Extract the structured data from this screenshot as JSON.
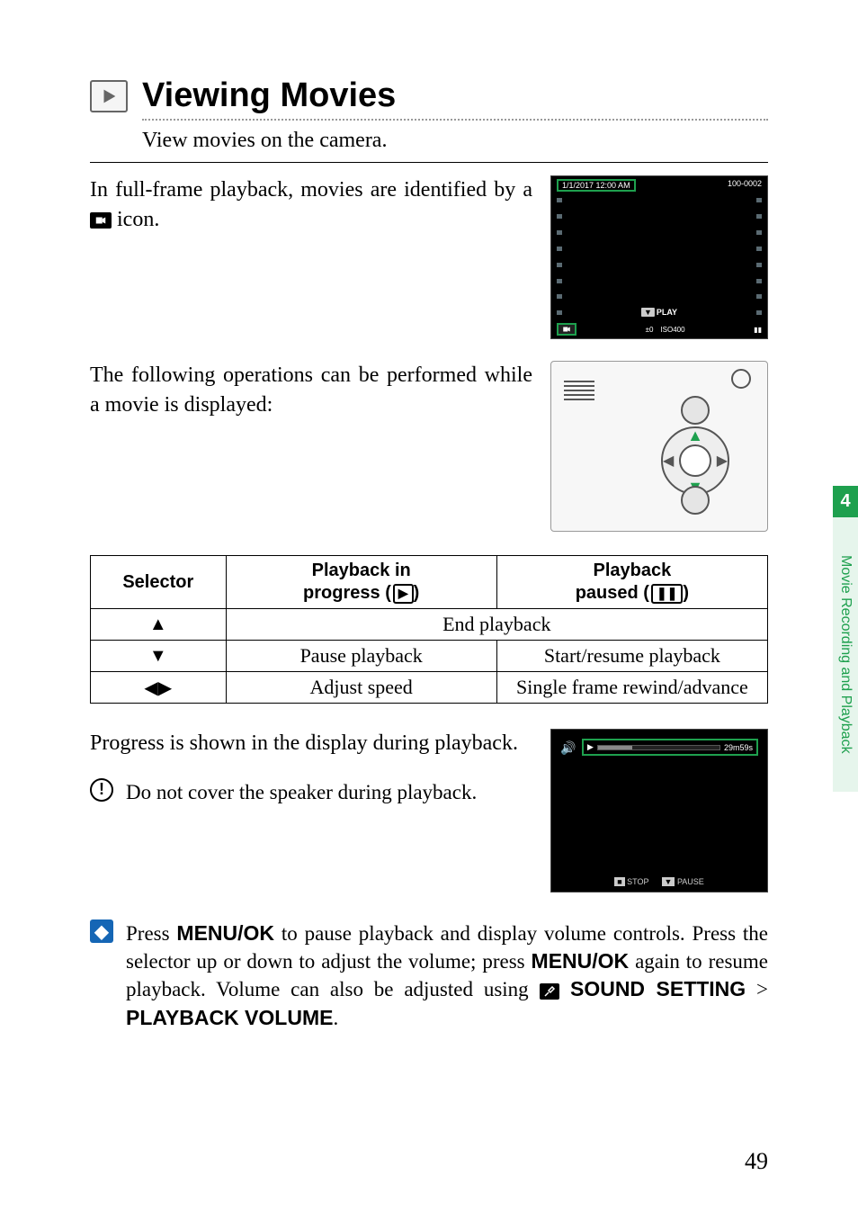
{
  "title": "Viewing Movies",
  "subtitle": "View movies on the camera.",
  "intro_prefix": "In full-frame playback, movies are identified by a ",
  "intro_suffix": " icon.",
  "ops_intro": "The following operations can be performed while a movie is displayed:",
  "lcd1": {
    "datetime": "1/1/2017 12:00 AM",
    "fileno": "100-0002",
    "play_label": "PLAY",
    "ev": "±0",
    "iso": "ISO400"
  },
  "table": {
    "headers": {
      "selector": "Selector",
      "progress_line1": "Playback in",
      "progress_line2": "progress (",
      "progress_line3": ")",
      "paused_line1": "Playback",
      "paused_line2": "paused (",
      "paused_line3": ")"
    },
    "rows": [
      {
        "selector": "▲",
        "merged": "End playback"
      },
      {
        "selector": "▼",
        "progress": "Pause playback",
        "paused": "Start/resume playback"
      },
      {
        "selector": "◀▶",
        "progress": "Adjust speed",
        "paused": "Single frame rewind/advance"
      }
    ]
  },
  "progress_text": "Progress is shown in the display during playback.",
  "lcd2": {
    "time": "29m59s",
    "stop": "STOP",
    "pause": "PAUSE"
  },
  "warn_note": "Do not cover the speaker during playback.",
  "tip": {
    "part1": "Press ",
    "menuok": "MENU/OK",
    "part2": " to pause playback and display volume controls. Press the selector up or down to adjust the volume; press ",
    "part3": " again to resume playback. Volume can also be adjusted using ",
    "sound_setting": " SOUND SETTING",
    "gt": " > ",
    "playback_volume": "PLAYBACK VOLUME",
    "period": "."
  },
  "side": {
    "chapter": "4",
    "label": "Movie Recording and Playback"
  },
  "page_number": "49"
}
